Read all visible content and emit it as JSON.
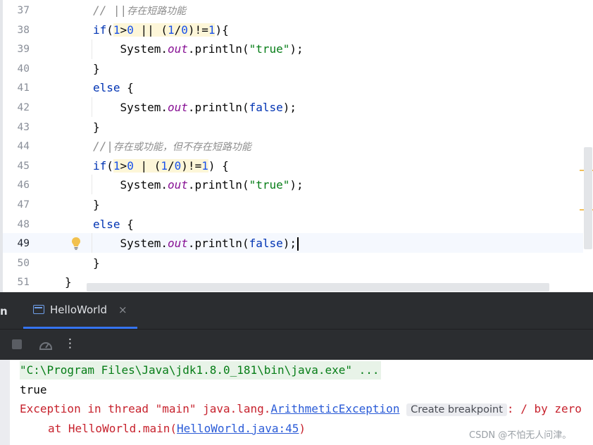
{
  "editor": {
    "active_line_number": "49",
    "lines": [
      {
        "num": "37",
        "tokens": [
          {
            "t": "// ||",
            "c": "cmt"
          },
          {
            "t": "存在短路功能",
            "c": "cmt cmt-cn"
          }
        ]
      },
      {
        "num": "38",
        "tokens": [
          {
            "t": "if",
            "c": "kw"
          },
          {
            "t": "("
          },
          {
            "t": "1",
            "c": "num hl"
          },
          {
            "t": ">",
            "c": "hl"
          },
          {
            "t": "0",
            "c": "num hl"
          },
          {
            "t": " || ",
            "c": "hl"
          },
          {
            "t": "(",
            "c": "hl"
          },
          {
            "t": "1",
            "c": "num hl"
          },
          {
            "t": "/",
            "c": "hl"
          },
          {
            "t": "0",
            "c": "num hl"
          },
          {
            "t": ")!=",
            "c": "hl"
          },
          {
            "t": "1",
            "c": "num hl"
          },
          {
            "t": "){"
          }
        ]
      },
      {
        "num": "39",
        "tokens": [
          {
            "t": "    System."
          },
          {
            "t": "out",
            "c": "fld"
          },
          {
            "t": ".println("
          },
          {
            "t": "\"true\"",
            "c": "str"
          },
          {
            "t": ");"
          }
        ]
      },
      {
        "num": "40",
        "tokens": [
          {
            "t": "}"
          }
        ]
      },
      {
        "num": "41",
        "tokens": [
          {
            "t": "else",
            "c": "kw"
          },
          {
            "t": " {"
          }
        ]
      },
      {
        "num": "42",
        "tokens": [
          {
            "t": "    System."
          },
          {
            "t": "out",
            "c": "fld"
          },
          {
            "t": ".println("
          },
          {
            "t": "false",
            "c": "kw"
          },
          {
            "t": ");"
          }
        ]
      },
      {
        "num": "43",
        "tokens": [
          {
            "t": "}"
          }
        ]
      },
      {
        "num": "44",
        "tokens": [
          {
            "t": "//|",
            "c": "cmt"
          },
          {
            "t": "存在或功能，但不存在短路功能",
            "c": "cmt cmt-cn"
          }
        ]
      },
      {
        "num": "45",
        "tokens": [
          {
            "t": "if",
            "c": "kw"
          },
          {
            "t": "("
          },
          {
            "t": "1",
            "c": "num hl"
          },
          {
            "t": ">",
            "c": "hl"
          },
          {
            "t": "0",
            "c": "num hl"
          },
          {
            "t": " | ",
            "c": "hl"
          },
          {
            "t": "(",
            "c": "hl"
          },
          {
            "t": "1",
            "c": "num hl"
          },
          {
            "t": "/",
            "c": "hl"
          },
          {
            "t": "0",
            "c": "num hl"
          },
          {
            "t": ")!=",
            "c": "hl"
          },
          {
            "t": "1",
            "c": "num hl"
          },
          {
            "t": ") {"
          }
        ]
      },
      {
        "num": "46",
        "tokens": [
          {
            "t": "    System."
          },
          {
            "t": "out",
            "c": "fld"
          },
          {
            "t": ".println("
          },
          {
            "t": "\"true\"",
            "c": "str"
          },
          {
            "t": ");"
          }
        ]
      },
      {
        "num": "47",
        "tokens": [
          {
            "t": "}"
          }
        ]
      },
      {
        "num": "48",
        "tokens": [
          {
            "t": "else",
            "c": "kw"
          },
          {
            "t": " {"
          }
        ]
      },
      {
        "num": "49",
        "tokens": [
          {
            "t": "    System."
          },
          {
            "t": "out",
            "c": "fld"
          },
          {
            "t": ".println("
          },
          {
            "t": "false",
            "c": "kw"
          },
          {
            "t": ");"
          }
        ],
        "caret": true
      },
      {
        "num": "50",
        "tokens": [
          {
            "t": "}"
          }
        ]
      },
      {
        "num": "51",
        "tokens": [
          {
            "t": "}"
          }
        ],
        "outer": true
      }
    ]
  },
  "run_window": {
    "side_label": "n",
    "tab_label": "HelloWorld",
    "tab_close": "×",
    "more_glyph": "⋮"
  },
  "console": {
    "command": "\"C:\\Program Files\\Java\\jdk1.8.0_181\\bin\\java.exe\" ...",
    "output_true": "true",
    "exc_prefix": "Exception in thread \"main\" java.lang.",
    "exc_class": "ArithmeticException",
    "create_breakpoint": "Create breakpoint",
    "exc_suffix": ": / by zero",
    "at_prefix": "at HelloWorld.main(",
    "at_link": "HelloWorld.java:45",
    "at_suffix": ")"
  },
  "watermark": "CSDN @不怕无人问津。",
  "colors": {
    "keyword": "#0033b3",
    "number": "#1750eb",
    "string": "#067d17",
    "field": "#871094",
    "comment": "#8c8c8c",
    "error": "#c7222d",
    "link": "#2a5bd7",
    "tab_accent": "#3574f0"
  }
}
